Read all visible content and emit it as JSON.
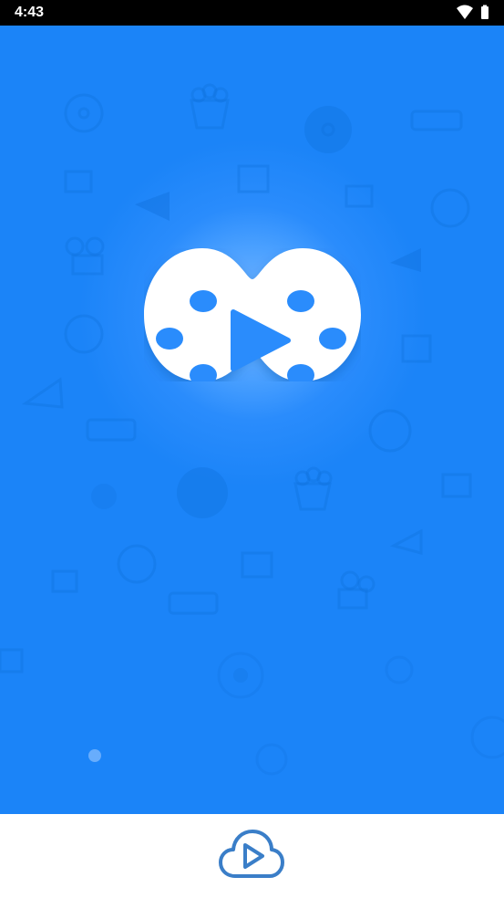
{
  "status_bar": {
    "time": "4:43",
    "icons": [
      "wifi-icon",
      "battery-icon"
    ]
  },
  "splash": {
    "background_color": "#1b84f8",
    "glow_color": "#79b8ff",
    "logo_icon": "film-reel-play-icon",
    "logo_color": "#ffffff",
    "decor_icons": [
      "film-reel-icon",
      "popcorn-icon",
      "disc-icon",
      "3d-glasses-icon",
      "clapperboard-icon",
      "film-frame-icon",
      "megaphone-icon",
      "movie-camera-icon"
    ]
  },
  "footer": {
    "icon": "cloud-play-icon",
    "icon_color": "#3a7ec8"
  }
}
